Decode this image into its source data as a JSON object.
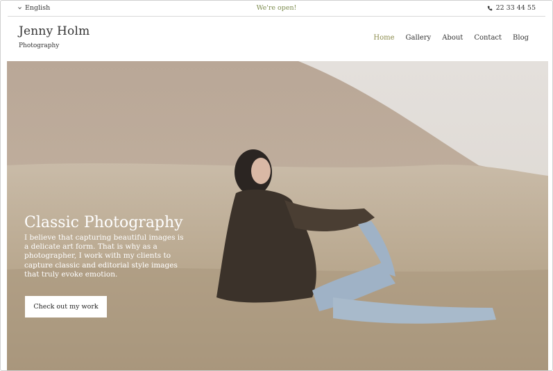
{
  "topbar": {
    "language": "English",
    "status": "We're open!",
    "phone": "22 33 44 55"
  },
  "brand": {
    "name": "Jenny Holm",
    "tagline": "Photography"
  },
  "nav": {
    "items": [
      "Home",
      "Gallery",
      "About",
      "Contact",
      "Blog"
    ],
    "active": "Home"
  },
  "hero": {
    "title": "Classic Photography",
    "text": "I believe that capturing beautiful images is a delicate art form. That is why as a photographer, I work with my clients to capture classic and editorial style images that truly evoke emotion.",
    "button_label": "Check out my work"
  },
  "icons": {
    "language": "chevron-down-icon",
    "phone": "phone-icon"
  },
  "colors": {
    "accent": "#7d8c4f",
    "nav_active": "#8a8a4a"
  }
}
